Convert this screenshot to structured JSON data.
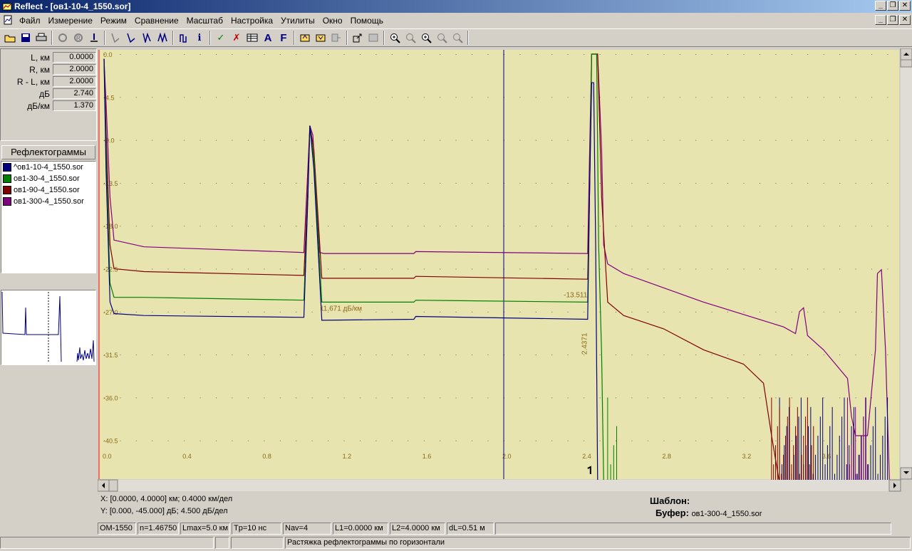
{
  "window": {
    "title": "Reflect - [ов1-10-4_1550.sor]"
  },
  "menu": [
    "Файл",
    "Измерение",
    "Режим",
    "Сравнение",
    "Масштаб",
    "Настройка",
    "Утилиты",
    "Окно",
    "Помощь"
  ],
  "params": [
    {
      "label": "L, км",
      "value": "0.0000"
    },
    {
      "label": "R, км",
      "value": "2.0000"
    },
    {
      "label": "R - L, км",
      "value": "2.0000"
    },
    {
      "label": "дБ",
      "value": "2.740"
    },
    {
      "label": "дБ/км",
      "value": "1.370"
    }
  ],
  "reflectograms": {
    "header": "Рефлектограммы",
    "items": [
      {
        "name": "^ов1-10-4_1550.sor",
        "color": "#000080"
      },
      {
        "name": "ов1-30-4_1550.sor",
        "color": "#008000"
      },
      {
        "name": "ов1-90-4_1550.sor",
        "color": "#800000"
      },
      {
        "name": "ов1-300-4_1550.sor",
        "color": "#800080"
      }
    ]
  },
  "chart_data": {
    "type": "line",
    "x_ticks": [
      "0.0",
      "0.4",
      "0.8",
      "1.2",
      "1.6",
      "2.0",
      "2.4",
      "2.8",
      "3.2",
      "3.6"
    ],
    "y_ticks": [
      "0.0",
      "-4.5",
      "-9.0",
      "-13.5",
      "-18.0",
      "-22.5",
      "-27.0",
      "-31.5",
      "-36.0",
      "-40.5"
    ],
    "xlim": [
      0,
      4.0
    ],
    "ylim": [
      0,
      -45
    ],
    "cursor_x": 2.0,
    "annotations": {
      "slope_label": "11.671 дБ/км",
      "level_label": "-13.511",
      "event_label": "2.4371"
    },
    "series": [
      {
        "color": "#800080",
        "points": [
          [
            0.0,
            -0.5
          ],
          [
            0.01,
            -5
          ],
          [
            0.03,
            -15
          ],
          [
            0.05,
            -19.5
          ],
          [
            0.2,
            -20.2
          ],
          [
            1.0,
            -20.8
          ],
          [
            1.02,
            -12
          ],
          [
            1.03,
            -7.5
          ],
          [
            1.045,
            -8.5
          ],
          [
            1.08,
            -20.8
          ],
          [
            1.1,
            -20.9
          ],
          [
            1.55,
            -20.9
          ],
          [
            1.56,
            -20.7
          ],
          [
            2.42,
            -20.9
          ],
          [
            2.43,
            -10
          ],
          [
            2.44,
            0
          ],
          [
            2.47,
            0
          ],
          [
            2.49,
            -10
          ],
          [
            2.5,
            -20
          ],
          [
            2.52,
            -22
          ],
          [
            2.6,
            -23
          ],
          [
            3.0,
            -26
          ],
          [
            3.4,
            -28.6
          ],
          [
            3.46,
            -29.3
          ],
          [
            3.48,
            -27
          ],
          [
            3.5,
            -26.6
          ],
          [
            3.52,
            -29.5
          ],
          [
            3.6,
            -31
          ],
          [
            3.72,
            -34
          ],
          [
            3.74,
            -38
          ],
          [
            3.76,
            -40
          ],
          [
            3.82,
            -40
          ],
          [
            3.86,
            -31
          ],
          [
            3.87,
            -23
          ],
          [
            3.89,
            -22.6
          ],
          [
            3.91,
            -31
          ],
          [
            3.93,
            -45
          ]
        ]
      },
      {
        "color": "#800000",
        "points": [
          [
            0.0,
            -0.5
          ],
          [
            0.01,
            -8
          ],
          [
            0.03,
            -20
          ],
          [
            0.05,
            -22.5
          ],
          [
            0.2,
            -22.8
          ],
          [
            1.0,
            -23.2
          ],
          [
            1.02,
            -14
          ],
          [
            1.03,
            -7.5
          ],
          [
            1.05,
            -10
          ],
          [
            1.09,
            -23.5
          ],
          [
            1.55,
            -23.5
          ],
          [
            1.56,
            -23.3
          ],
          [
            2.42,
            -23.6
          ],
          [
            2.43,
            -14
          ],
          [
            2.44,
            0
          ],
          [
            2.47,
            0
          ],
          [
            2.49,
            -15
          ],
          [
            2.52,
            -26
          ],
          [
            2.6,
            -27.4
          ],
          [
            2.8,
            -28.8
          ],
          [
            3.0,
            -31
          ],
          [
            3.2,
            -32.5
          ],
          [
            3.3,
            -34.5
          ],
          [
            3.34,
            -40
          ],
          [
            3.38,
            -45
          ]
        ]
      },
      {
        "color": "#008000",
        "points": [
          [
            0.0,
            -0.5
          ],
          [
            0.01,
            -10
          ],
          [
            0.03,
            -24
          ],
          [
            0.05,
            -25.5
          ],
          [
            0.2,
            -25.5
          ],
          [
            1.0,
            -25.8
          ],
          [
            1.02,
            -15
          ],
          [
            1.03,
            -7.5
          ],
          [
            1.05,
            -11
          ],
          [
            1.09,
            -26
          ],
          [
            1.55,
            -26
          ],
          [
            1.56,
            -25.8
          ],
          [
            2.42,
            -26
          ],
          [
            2.43,
            -14
          ],
          [
            2.44,
            0
          ],
          [
            2.465,
            0
          ],
          [
            2.475,
            -20
          ],
          [
            2.49,
            -31.5
          ],
          [
            2.5,
            -45
          ]
        ]
      },
      {
        "color": "#000080",
        "points": [
          [
            0.0,
            -0.5
          ],
          [
            0.01,
            -12
          ],
          [
            0.03,
            -26
          ],
          [
            0.05,
            -27.2
          ],
          [
            0.2,
            -27.4
          ],
          [
            1.0,
            -27.6
          ],
          [
            1.02,
            -15
          ],
          [
            1.03,
            -7.5
          ],
          [
            1.05,
            -12
          ],
          [
            1.09,
            -27.9
          ],
          [
            1.55,
            -27.8
          ],
          [
            1.56,
            -27.5
          ],
          [
            2.42,
            -27.8
          ],
          [
            2.43,
            -14
          ],
          [
            2.44,
            -3
          ],
          [
            2.45,
            -3
          ],
          [
            2.46,
            -20
          ],
          [
            2.47,
            -45
          ]
        ]
      }
    ]
  },
  "info": {
    "x_line": "X: [0.0000, 4.0000] км; 0.4000 км/дел",
    "y_line": "Y: [0.000, -45.000] дБ; 4.500 дБ/дел",
    "template_label": "Шаблон:",
    "buffer_label": "Буфер:",
    "buffer_value": "ов1-300-4_1550.sor"
  },
  "status": [
    "OM-1550",
    "n=1.46750",
    "Lmax=5.0 км",
    "Tp=10 нс",
    "Nav=4",
    "L1=0.0000 км",
    "L2=4.0000 км",
    "dL=0.51 м"
  ],
  "statusbar2": {
    "hint": "Растяжка рефлектограммы по горизонтали"
  }
}
